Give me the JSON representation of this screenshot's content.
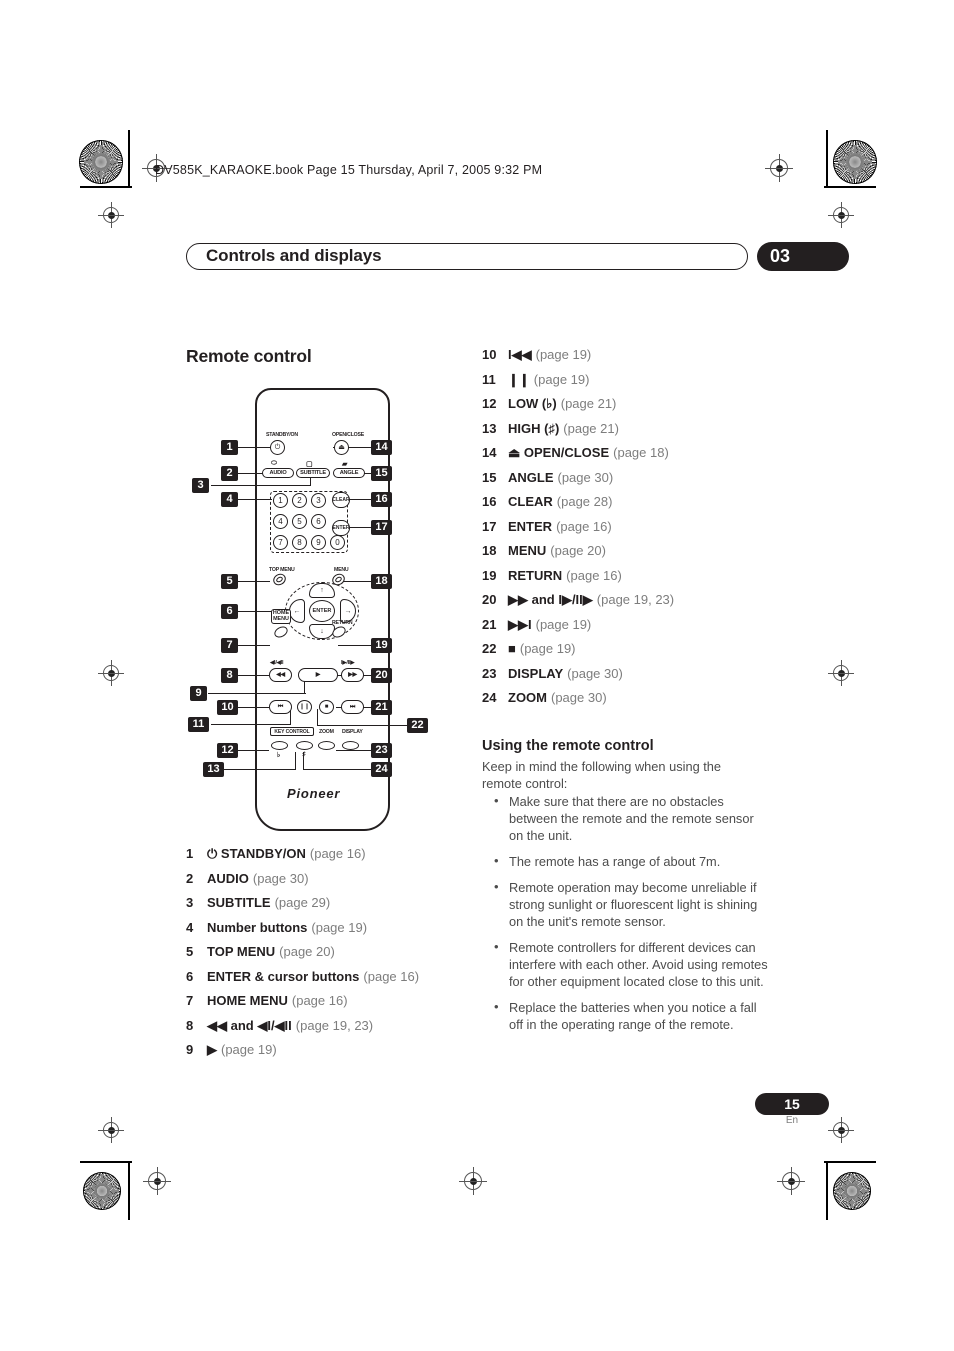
{
  "print_marks": {
    "file_info": "DV585K_KARAOKE.book  Page 15  Thursday, April 7, 2005  9:32 PM"
  },
  "header": {
    "chapter_title": "Controls and displays",
    "chapter_number": "03"
  },
  "section": {
    "heading": "Remote control"
  },
  "remote": {
    "brand": "Pioneer",
    "labels": {
      "standby_on": "STANDBY/ON",
      "open_close": "OPEN/CLOSE",
      "audio": "AUDIO",
      "subtitle": "SUBTITLE",
      "angle": "ANGLE",
      "clear": "CLEAR",
      "enter_btn": "ENTER",
      "top_menu": "TOP MENU",
      "menu": "MENU",
      "home_menu_line1": "HOME",
      "home_menu_line2": "MENU",
      "return": "RETURN",
      "key_control": "KEY CONTROL",
      "zoom": "ZOOM",
      "display": "DISPLAY",
      "nav_enter": "ENTER",
      "low_flat": "♭",
      "high_sharp": "♯",
      "rev_step": "◀I/◀II",
      "fwd_step": "I▶/II▶",
      "power_glyph": "⏻",
      "eject_glyph": "⏏",
      "audio_icon": "⬭",
      "subtitle_icon": "▢",
      "angle_icon": "▰",
      "prev_glyph": "⏮",
      "next_glyph": "⏭",
      "rew_glyph": "◀◀",
      "ffwd_glyph": "▶▶",
      "play_glyph": "▶",
      "pause_glyph": "❙❙",
      "stop_glyph": "■",
      "arrow_up": "↑",
      "arrow_down": "↓",
      "arrow_left": "←",
      "arrow_right": "→"
    },
    "number_keys": [
      "1",
      "2",
      "3",
      "4",
      "5",
      "6",
      "7",
      "8",
      "9",
      "0"
    ],
    "callouts": [
      "1",
      "2",
      "3",
      "4",
      "5",
      "6",
      "7",
      "8",
      "9",
      "10",
      "11",
      "12",
      "13",
      "14",
      "15",
      "16",
      "17",
      "18",
      "19",
      "20",
      "21",
      "22",
      "23",
      "24"
    ]
  },
  "list_left": [
    {
      "n": "1",
      "label": "⏻ STANDBY/ON",
      "page": "(page 16)"
    },
    {
      "n": "2",
      "label": "AUDIO",
      "page": "(page 30)"
    },
    {
      "n": "3",
      "label": "SUBTITLE",
      "page": "(page 29)"
    },
    {
      "n": "4",
      "label": "Number buttons",
      "page": "(page 19)"
    },
    {
      "n": "5",
      "label": "TOP MENU",
      "page": "(page 20)"
    },
    {
      "n": "6",
      "label": "ENTER & cursor buttons",
      "page": "(page 16)"
    },
    {
      "n": "7",
      "label": "HOME MENU",
      "page": "(page 16)"
    },
    {
      "n": "8",
      "label": "◀◀ and ◀I/◀II",
      "page": "(page 19, 23)"
    },
    {
      "n": "9",
      "label": "▶",
      "page": "(page 19)"
    }
  ],
  "list_right": [
    {
      "n": "10",
      "label": "I◀◀",
      "page": "(page 19)"
    },
    {
      "n": "11",
      "label": "❙❙",
      "page": "(page 19)"
    },
    {
      "n": "12",
      "label": "LOW (♭)",
      "page": "(page 21)"
    },
    {
      "n": "13",
      "label": "HIGH (♯)",
      "page": "(page 21)"
    },
    {
      "n": "14",
      "label": "⏏ OPEN/CLOSE",
      "page": "(page 18)"
    },
    {
      "n": "15",
      "label": "ANGLE",
      "page": "(page 30)"
    },
    {
      "n": "16",
      "label": "CLEAR",
      "page": "(page 28)"
    },
    {
      "n": "17",
      "label": "ENTER",
      "page": "(page 16)"
    },
    {
      "n": "18",
      "label": "MENU",
      "page": "(page 20)"
    },
    {
      "n": "19",
      "label": "RETURN",
      "page": "(page 16)"
    },
    {
      "n": "20",
      "label": "▶▶ and I▶/II▶",
      "page": "(page 19, 23)"
    },
    {
      "n": "21",
      "label": "▶▶I",
      "page": "(page 19)"
    },
    {
      "n": "22",
      "label": "■",
      "page": "(page 19)"
    },
    {
      "n": "23",
      "label": "DISPLAY",
      "page": "(page 30)"
    },
    {
      "n": "24",
      "label": "ZOOM",
      "page": "(page 30)"
    }
  ],
  "using_remote": {
    "heading": "Using the remote control",
    "intro": "Keep in mind the following when using the remote control:",
    "bullets": [
      "Make sure that there are no obstacles between the remote and the remote sensor on the unit.",
      "The remote has a range of about 7m.",
      "Remote operation may become unreliable if strong sunlight or fluorescent light is shining on the unit's remote sensor.",
      "Remote controllers for different devices can interfere with each other. Avoid using remotes for other equipment located close to this unit.",
      "Replace the batteries when you notice a fall off in the operating range of the remote."
    ]
  },
  "footer": {
    "page_number": "15",
    "language": "En"
  }
}
